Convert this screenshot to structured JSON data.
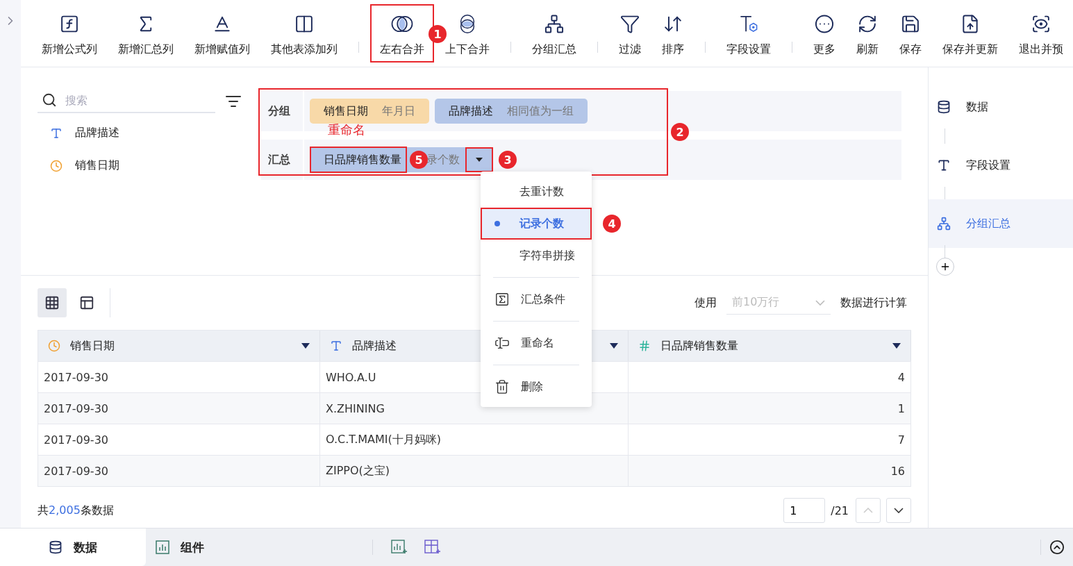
{
  "toolbar": {
    "groups": [
      [
        {
          "label": "新增公式列",
          "highlighted": false
        },
        {
          "label": "新增汇总列",
          "highlighted": false
        },
        {
          "label": "新增赋值列",
          "highlighted": false
        },
        {
          "label": "其他表添加列",
          "highlighted": false
        }
      ],
      [
        {
          "label": "左右合并",
          "highlighted": true,
          "badge": "1"
        },
        {
          "label": "上下合并",
          "highlighted": false
        }
      ],
      [
        {
          "label": "分组汇总",
          "highlighted": false
        }
      ],
      [
        {
          "label": "过滤",
          "highlighted": false
        },
        {
          "label": "排序",
          "highlighted": false
        }
      ],
      [
        {
          "label": "字段设置",
          "highlighted": false
        }
      ],
      [
        {
          "label": "更多",
          "highlighted": false
        },
        {
          "label": "刷新",
          "highlighted": false
        },
        {
          "label": "保存",
          "highlighted": false
        },
        {
          "label": "保存并更新",
          "highlighted": false
        },
        {
          "label": "退出并预",
          "highlighted": false
        }
      ]
    ]
  },
  "fields": {
    "search_placeholder": "搜索",
    "items": [
      {
        "label": "品牌描述",
        "kind": "text"
      },
      {
        "label": "销售日期",
        "kind": "date"
      }
    ]
  },
  "config": {
    "badge": "2",
    "annotation": "重命名",
    "group": {
      "label": "分组",
      "chips": [
        {
          "name": "销售日期",
          "setting": "年月日",
          "kind": "date"
        },
        {
          "name": "品牌描述",
          "setting": "相同值为一组",
          "kind": "text"
        }
      ]
    },
    "summary": {
      "label": "汇总",
      "chip": {
        "name": "日品牌销售数量",
        "name_badge": "5",
        "setting": "录个数",
        "caret_badge": "3"
      }
    }
  },
  "menu": {
    "items": [
      {
        "kind": "option",
        "label": "去重计数",
        "selected": false
      },
      {
        "kind": "option",
        "label": "记录个数",
        "selected": true,
        "badge": "4"
      },
      {
        "kind": "option",
        "label": "字符串拼接",
        "selected": false
      },
      {
        "kind": "action",
        "label": "汇总条件"
      },
      {
        "kind": "action",
        "label": "重命名"
      },
      {
        "kind": "action",
        "label": "删除"
      }
    ]
  },
  "preview": {
    "views": [
      {
        "selected": true
      },
      {
        "selected": false
      }
    ],
    "limit": {
      "prefix": "使用",
      "placeholder": "前10万行",
      "suffix": "数据进行计算"
    },
    "table": {
      "columns": [
        {
          "label": "销售日期",
          "kind": "date"
        },
        {
          "label": "品牌描述",
          "kind": "text"
        },
        {
          "label": "日品牌销售数量",
          "kind": "number"
        }
      ],
      "rows": [
        [
          "2017-09-30",
          "WHO.A.U",
          "4"
        ],
        [
          "2017-09-30",
          "X.ZHINING",
          "1"
        ],
        [
          "2017-09-30",
          "O.C.T.MAMI(十月妈咪)",
          "7"
        ],
        [
          "2017-09-30",
          "ZIPPO(之宝)",
          "16"
        ]
      ]
    },
    "footer": {
      "prefix": "共",
      "count": "2,005",
      "suffix": "条数据",
      "page": "1",
      "total": "/21"
    }
  },
  "steps": [
    {
      "label": "数据",
      "selected": false
    },
    {
      "label": "字段设置",
      "selected": false
    },
    {
      "label": "分组汇总",
      "selected": true
    }
  ],
  "bottom_tabs": [
    {
      "label": "数据",
      "selected": true
    },
    {
      "label": "组件",
      "selected": false
    }
  ]
}
